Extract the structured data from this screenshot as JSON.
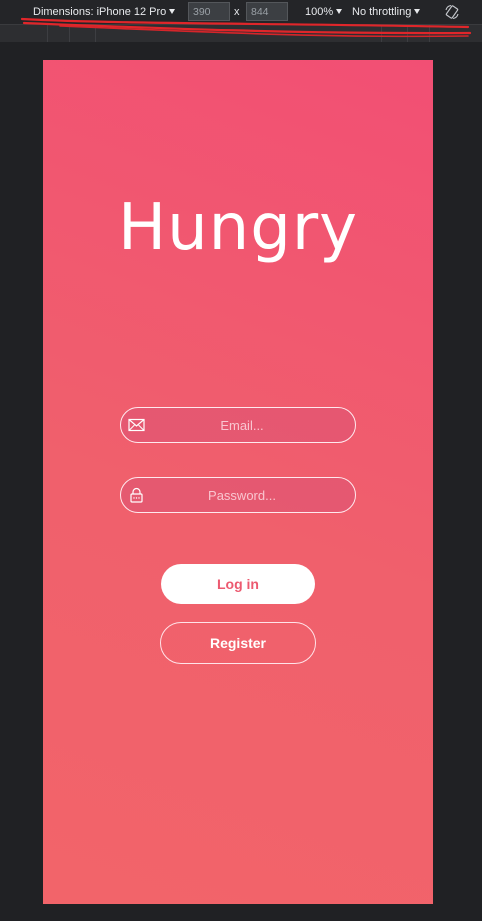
{
  "toolbar": {
    "dimensions_label": "Dimensions: iPhone 12 Pro",
    "width_value": "390",
    "separator": "x",
    "height_value": "844",
    "zoom_label": "100%",
    "throttle_label": "No throttling",
    "rotate_icon": "rotate-icon"
  },
  "app": {
    "title": "Hungry",
    "email": {
      "placeholder": "Email...",
      "icon": "envelope-icon"
    },
    "password": {
      "placeholder": "Password...",
      "icon": "lock-icon"
    },
    "login_label": "Log in",
    "register_label": "Register"
  },
  "colors": {
    "gradient_top": "#f24f74",
    "gradient_bottom": "#f2646a",
    "login_text": "#ec5a70",
    "annotation_red": "#e0262a"
  }
}
